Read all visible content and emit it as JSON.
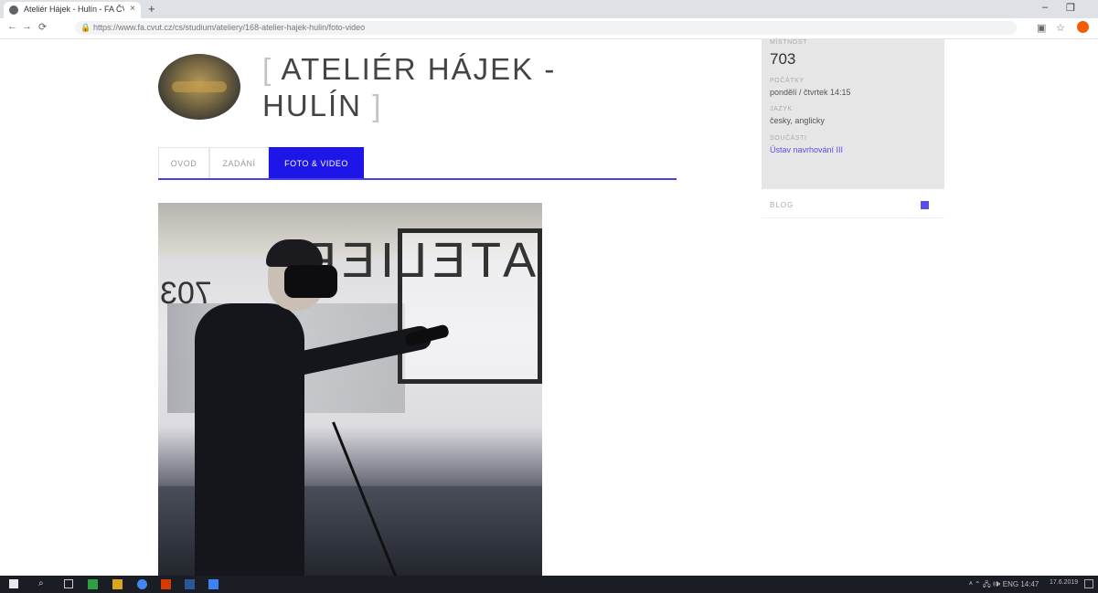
{
  "browser": {
    "tab_title": "Ateliér Hájek - Hulín - FA ČVUT",
    "url": "https://www.fa.cvut.cz/cs/studium/ateliery/168-atelier-hajek-hulin/foto-video",
    "close_glyph": "×",
    "newtab_glyph": "+",
    "nav": {
      "back": "←",
      "forward": "→",
      "reload": "⟳",
      "lock": "🔒"
    },
    "win_min": "–",
    "win_max": "❐",
    "ext_star": "☆"
  },
  "header": {
    "title_open": "[",
    "title_line1": "ATELIÉR HÁJEK -",
    "title_line2": "HULÍN",
    "title_close": "]"
  },
  "tabs": [
    {
      "label": "OVOD"
    },
    {
      "label": "ZADÁNÍ"
    },
    {
      "label": "FOTO & VIDEO"
    }
  ],
  "photo": {
    "sign_text": "ATELIER",
    "wall_number": "703"
  },
  "sidebar": {
    "room_label": "MÍSTNOST",
    "room_value": "703",
    "time_label": "POČÁTKY",
    "time_value": "pondělí / čtvrtek 14:15",
    "lang_label": "JAZYK",
    "lang_value": "česky, anglicky",
    "part_label": "SOUČÁSTI",
    "part_value": "Ústav navrhování III",
    "blog_label": "BLOG"
  },
  "taskbar": {
    "tray_text": "ᴬ ⌃ 🖧 🕪 ENG 14:47",
    "date": "17.6.2019"
  },
  "colors": {
    "accent": "#1e15e8",
    "underline": "#4a3dea",
    "link": "#5a4de8",
    "sidebar_bg": "#e6e6e6"
  }
}
